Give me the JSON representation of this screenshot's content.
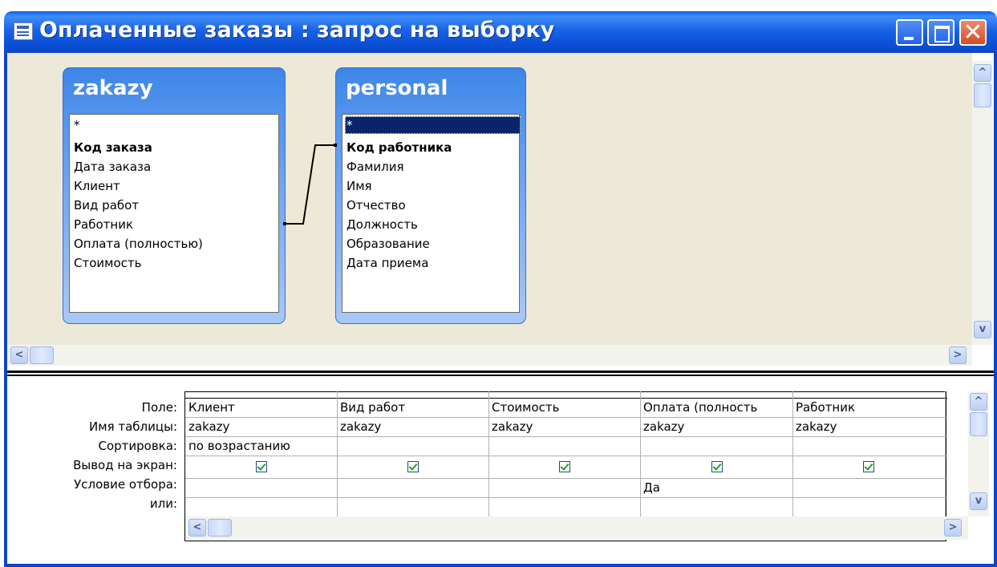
{
  "window": {
    "title": "Оплаченные заказы : запрос на выборку",
    "icon": "query-icon",
    "controls": {
      "minimize": "minimize-icon",
      "maximize": "maximize-icon",
      "close_label": "✕"
    },
    "accent_color": "#0c46c4"
  },
  "tables": [
    {
      "name": "zakazy",
      "fields": [
        "*",
        "Код заказа",
        "Дата заказа",
        "Клиент",
        "Вид работ",
        "Работник",
        "Оплата (полностью)",
        "Стоимость"
      ],
      "key_field": "Код заказа"
    },
    {
      "name": "personal",
      "fields": [
        "*",
        "Код работника",
        "Фамилия",
        "Имя",
        "Отчество",
        "Должность",
        "Образование",
        "Дата приема"
      ],
      "key_field": "Код работника",
      "selected_field": "*"
    }
  ],
  "relationship": {
    "from": "zakazy.Работник",
    "to": "personal.Код работника"
  },
  "grid": {
    "row_labels": [
      "Поле:",
      "Имя таблицы:",
      "Сортировка:",
      "Вывод на экран:",
      "Условие отбора:",
      "или:"
    ],
    "columns": [
      {
        "field": "Клиент",
        "table": "zakazy",
        "sort": "по возрастанию",
        "show": true,
        "criteria": ""
      },
      {
        "field": "Вид работ",
        "table": "zakazy",
        "sort": "",
        "show": true,
        "criteria": ""
      },
      {
        "field": "Стоимость",
        "table": "zakazy",
        "sort": "",
        "show": true,
        "criteria": ""
      },
      {
        "field": "Оплата (полность",
        "table": "zakazy",
        "sort": "",
        "show": true,
        "criteria": "Да"
      },
      {
        "field": "Работник",
        "table": "zakazy",
        "sort": "",
        "show": true,
        "criteria": ""
      }
    ]
  }
}
